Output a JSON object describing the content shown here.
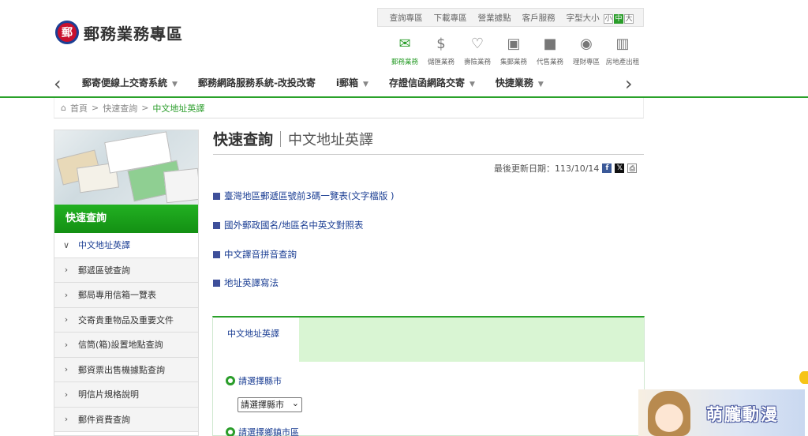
{
  "header": {
    "logo_mark": "郵",
    "logo_text": "郵務業務專區",
    "top_links": [
      "查詢專區",
      "下載專區",
      "營業據點",
      "客戶服務"
    ],
    "font_size_label": "字型大小",
    "font_sizes": [
      "小",
      "中",
      "大"
    ],
    "biz_icons": [
      {
        "label": "郵務業務",
        "icon": "envelope-icon",
        "glyph": "✉"
      },
      {
        "label": "儲匯業務",
        "icon": "money-icon",
        "glyph": "$"
      },
      {
        "label": "壽險業務",
        "icon": "heart-hands-icon",
        "glyph": "♡"
      },
      {
        "label": "集郵業務",
        "icon": "stamp-icon",
        "glyph": "▣"
      },
      {
        "label": "代售業務",
        "icon": "bag-icon",
        "glyph": "■"
      },
      {
        "label": "理財專區",
        "icon": "person-icon",
        "glyph": "◉"
      },
      {
        "label": "房地產出租",
        "icon": "building-icon",
        "glyph": "▥"
      }
    ]
  },
  "nav": {
    "items": [
      "郵寄便線上交寄系統",
      "郵務網路服務系統-改投改寄",
      "i郵箱",
      "存證信函網路交寄",
      "快捷業務"
    ],
    "has_caret": [
      true,
      false,
      true,
      true,
      true
    ],
    "left_arrow": "‹",
    "right_arrow": "›"
  },
  "breadcrumb": {
    "home_icon": "⌂",
    "home": "首頁",
    "sep": ">",
    "level1": "快速查詢",
    "current": "中文地址英譯"
  },
  "sidebar": {
    "heading": "快速查詢",
    "items": [
      {
        "label": "中文地址英譯",
        "chev": "∨"
      },
      {
        "label": "郵遞區號查詢",
        "chev": "›"
      },
      {
        "label": "郵局專用信箱一覽表",
        "chev": "›"
      },
      {
        "label": "交寄貴重物品及重要文件",
        "chev": "›"
      },
      {
        "label": "信筒(箱)設置地點查詢",
        "chev": "›"
      },
      {
        "label": "郵資票出售機據點查詢",
        "chev": "›"
      },
      {
        "label": "明信片規格說明",
        "chev": "›"
      },
      {
        "label": "郵件資費查詢",
        "chev": "›"
      }
    ]
  },
  "main": {
    "title": "快速查詢",
    "subtitle": "中文地址英譯",
    "updated": "最後更新日期：113/10/14",
    "social": {
      "fb": "f",
      "x": "𝕏",
      "print": "⎙"
    },
    "links": [
      "臺灣地區郵遞區號前3碼一覽表(文字檔版 )",
      "國外郵政國名/地區名中英文對照表",
      "中文譯音拼音查詢",
      "地址英譯寫法"
    ],
    "panel": {
      "tab": "中文地址英譯",
      "field1_label": "請選擇縣市",
      "select1_value": "請選擇縣市",
      "select_caret": "⌄",
      "field2_label": "請選擇鄉鎮市區"
    }
  },
  "mascot": {
    "text": "萌朧動漫"
  }
}
